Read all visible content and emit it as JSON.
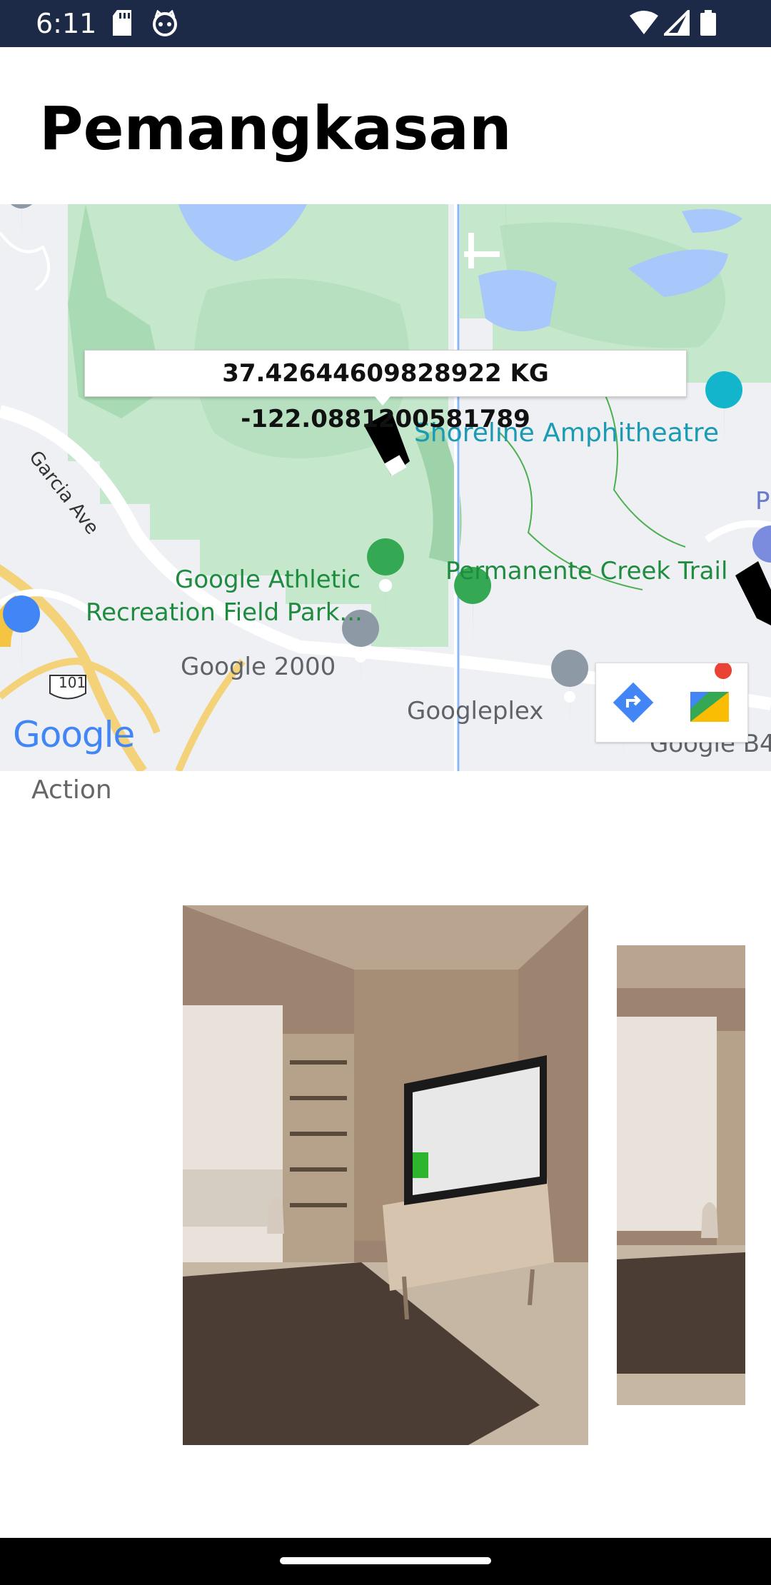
{
  "status_bar": {
    "time": "6:11",
    "left_icons": [
      "sd-card-icon",
      "cat-face-icon"
    ],
    "right_icons": [
      "wifi-icon",
      "cell-signal-icon",
      "battery-icon"
    ]
  },
  "header": {
    "title": "Pemangkasan"
  },
  "map": {
    "coordinate_label": "37.42644609828922 KG -122.0881200581789",
    "labels": {
      "shoreline": "Shoreline Amphitheatre",
      "athletic_line1": "Google Athletic",
      "athletic_line2": "Recreation Field Park...",
      "creek_trail": "Permanente Creek Trail",
      "google_2000": "Google 2000",
      "googleplex": "Googleplex",
      "google_b4": "Google B4",
      "garcia_ave": "Garcia Ave",
      "partial_p": "P",
      "route_101": "101"
    },
    "google_logo": "Google",
    "marker_icons": [
      "saw-marker-icon",
      "saw-marker-icon"
    ],
    "buttons": [
      "directions-icon",
      "google-maps-icon"
    ]
  },
  "action": {
    "label": "Action"
  },
  "carousel": {
    "items": [
      "living-room-photo",
      "living-room-photo"
    ]
  }
}
